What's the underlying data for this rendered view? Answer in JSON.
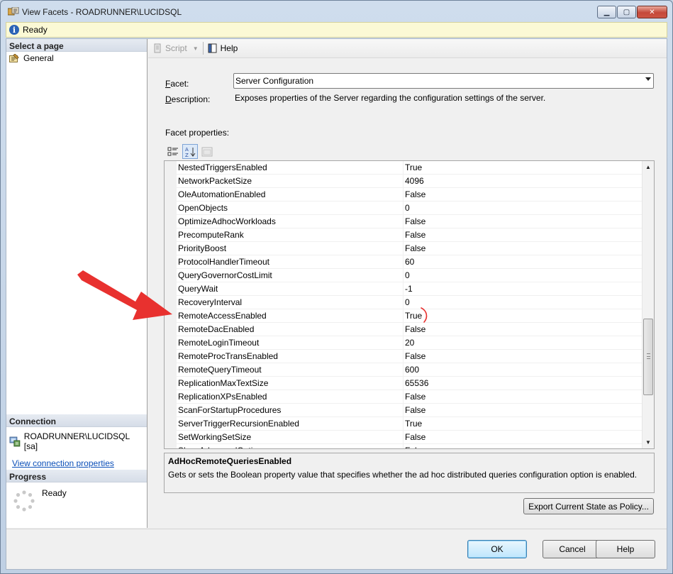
{
  "window": {
    "title": "View Facets - ROADRUNNER\\LUCIDSQL",
    "minimize": "▁",
    "maximize": "▢",
    "close": "✕"
  },
  "status": {
    "icon": "info-icon",
    "text": "Ready"
  },
  "sidebar": {
    "select_page_header": "Select a page",
    "pages": [
      {
        "label": "General",
        "icon": "page-icon"
      }
    ],
    "connection_header": "Connection",
    "connection_server": "ROADRUNNER\\LUCIDSQL [sa]",
    "connection_link": "View connection properties",
    "progress_header": "Progress",
    "progress_status": "Ready"
  },
  "toolbar": {
    "script_label": "Script",
    "help_label": "Help"
  },
  "facet": {
    "facet_label_mnemonic": "F",
    "facet_label_rest": "acet:",
    "facet_value": "Server Configuration",
    "description_label_mnemonic": "D",
    "description_label_rest": "escription:",
    "description_text": "Exposes properties of the Server regarding the configuration settings of the server.",
    "properties_label": "Facet properties:"
  },
  "properties": [
    {
      "name": "NestedTriggersEnabled",
      "value": "True"
    },
    {
      "name": "NetworkPacketSize",
      "value": "4096"
    },
    {
      "name": "OleAutomationEnabled",
      "value": "False"
    },
    {
      "name": "OpenObjects",
      "value": "0"
    },
    {
      "name": "OptimizeAdhocWorkloads",
      "value": "False"
    },
    {
      "name": "PrecomputeRank",
      "value": "False"
    },
    {
      "name": "PriorityBoost",
      "value": "False"
    },
    {
      "name": "ProtocolHandlerTimeout",
      "value": "60"
    },
    {
      "name": "QueryGovernorCostLimit",
      "value": "0"
    },
    {
      "name": "QueryWait",
      "value": "-1"
    },
    {
      "name": "RecoveryInterval",
      "value": "0"
    },
    {
      "name": "RemoteAccessEnabled",
      "value": "True"
    },
    {
      "name": "RemoteDacEnabled",
      "value": "False"
    },
    {
      "name": "RemoteLoginTimeout",
      "value": "20"
    },
    {
      "name": "RemoteProcTransEnabled",
      "value": "False"
    },
    {
      "name": "RemoteQueryTimeout",
      "value": "600"
    },
    {
      "name": "ReplicationMaxTextSize",
      "value": "65536"
    },
    {
      "name": "ReplicationXPsEnabled",
      "value": "False"
    },
    {
      "name": "ScanForStartupProcedures",
      "value": "False"
    },
    {
      "name": "ServerTriggerRecursionEnabled",
      "value": "True"
    },
    {
      "name": "SetWorkingSetSize",
      "value": "False"
    },
    {
      "name": "ShowAdvancedOptions",
      "value": "False"
    }
  ],
  "help_panel": {
    "title": "AdHocRemoteQueriesEnabled",
    "text": "Gets or sets the Boolean property value that specifies whether the ad hoc distributed queries configuration option is enabled."
  },
  "buttons": {
    "export": "Export Current State as Policy...",
    "ok": "OK",
    "cancel": "Cancel",
    "help": "Help"
  },
  "colors": {
    "annotation": "#e8312f",
    "link": "#0b4fb8",
    "titlebar": "#cfdded"
  }
}
